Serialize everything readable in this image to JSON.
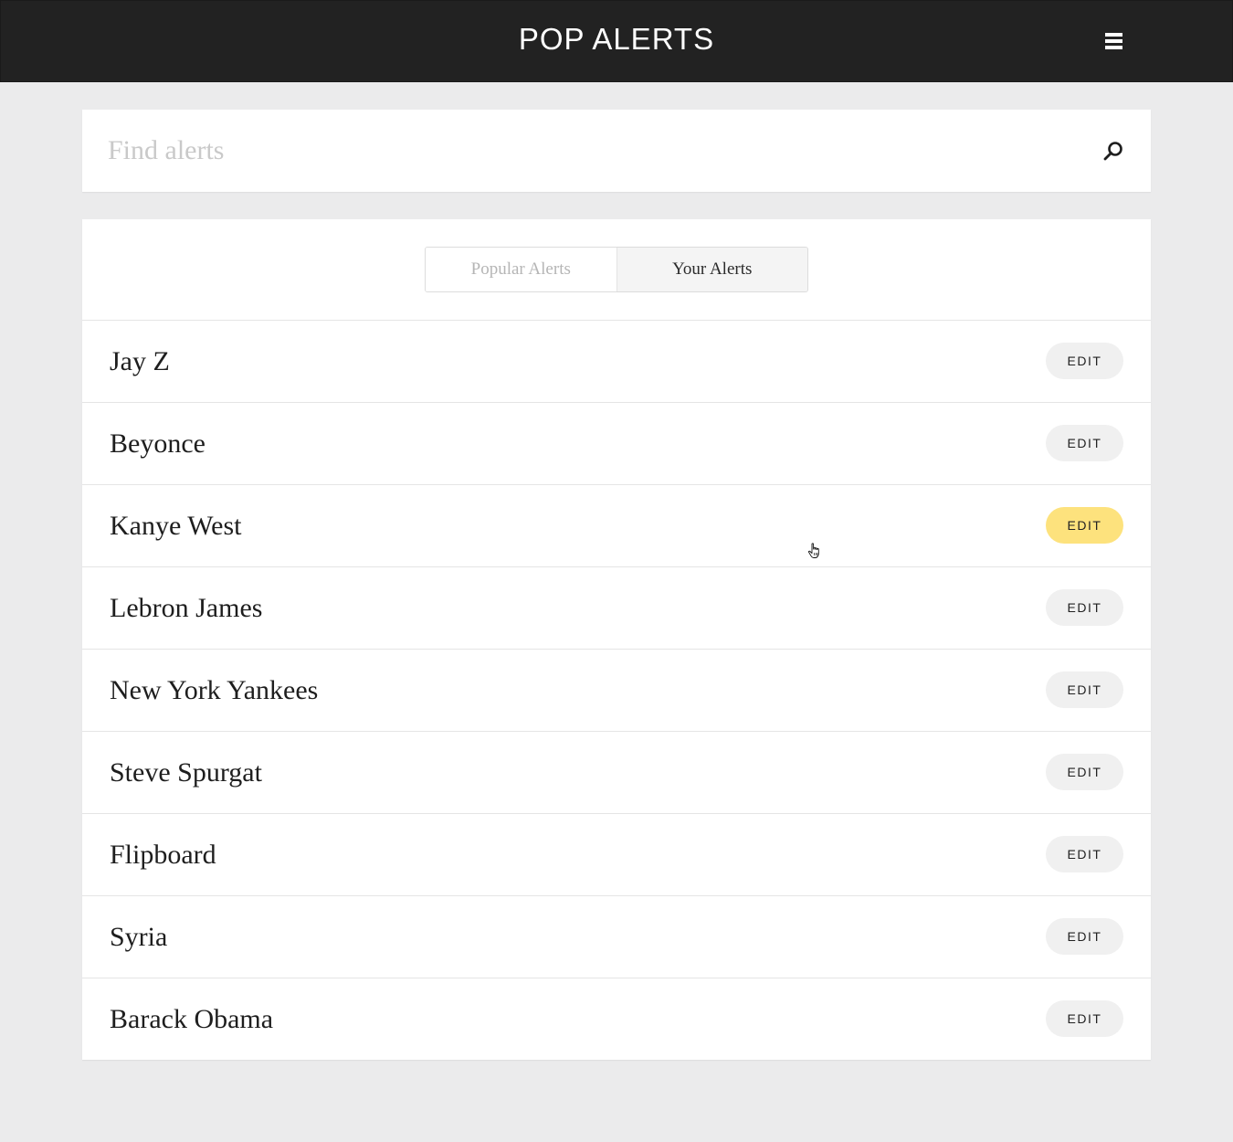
{
  "header": {
    "title": "POP ALERTS",
    "menu_icon": "hamburger-menu-icon"
  },
  "search": {
    "placeholder": "Find alerts",
    "value": "",
    "icon": "search-icon"
  },
  "tabs": [
    {
      "label": "Popular Alerts",
      "active": false
    },
    {
      "label": "Your Alerts",
      "active": true
    }
  ],
  "alerts": [
    {
      "name": "Jay Z",
      "edit_label": "EDIT"
    },
    {
      "name": "Beyonce",
      "edit_label": "EDIT"
    },
    {
      "name": "Kanye West",
      "edit_label": "EDIT"
    },
    {
      "name": "Lebron James",
      "edit_label": "EDIT"
    },
    {
      "name": "New York Yankees",
      "edit_label": "EDIT"
    },
    {
      "name": "Steve Spurgat",
      "edit_label": "EDIT"
    },
    {
      "name": "Flipboard",
      "edit_label": "EDIT"
    },
    {
      "name": "Syria",
      "edit_label": "EDIT"
    },
    {
      "name": "Barack Obama",
      "edit_label": "EDIT"
    }
  ],
  "colors": {
    "header_bg": "#222222",
    "page_bg": "#ebebec",
    "edit_hover": "#fde27d",
    "edit_default": "#f0f0f0"
  }
}
